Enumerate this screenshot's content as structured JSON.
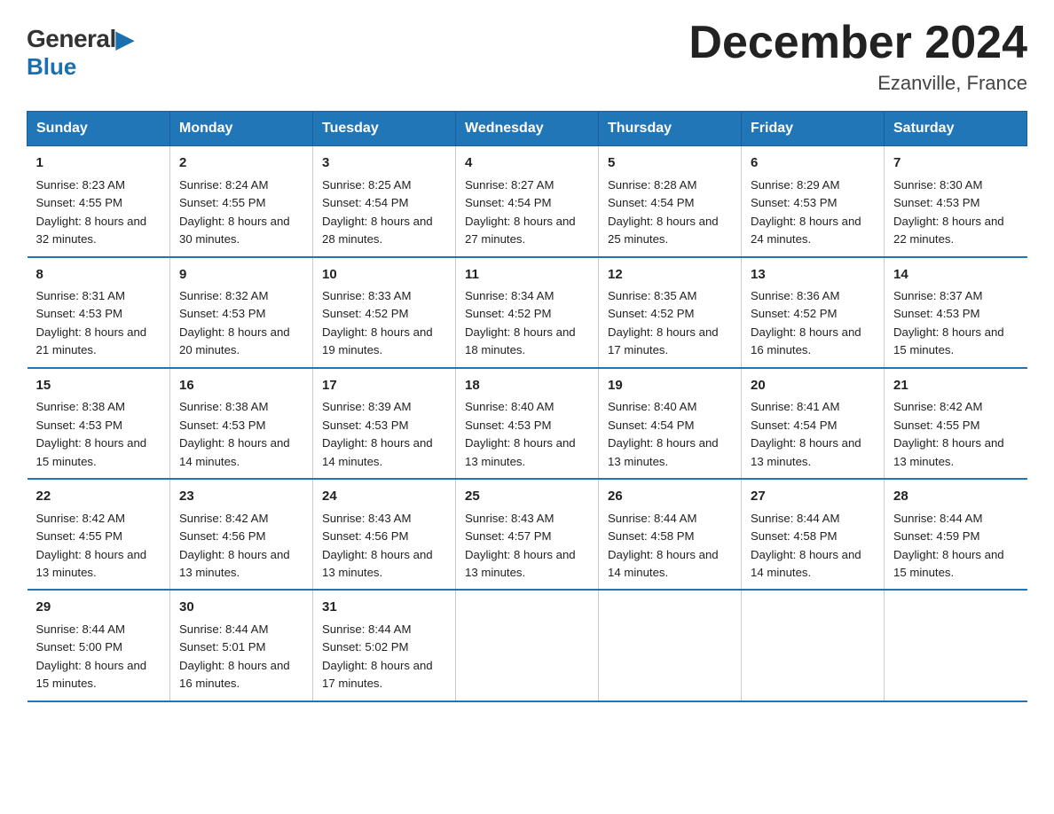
{
  "logo": {
    "general": "General",
    "blue": "Blue",
    "triangle": true
  },
  "title": "December 2024",
  "subtitle": "Ezanville, France",
  "days_of_week": [
    "Sunday",
    "Monday",
    "Tuesday",
    "Wednesday",
    "Thursday",
    "Friday",
    "Saturday"
  ],
  "weeks": [
    [
      {
        "day": "1",
        "sunrise": "8:23 AM",
        "sunset": "4:55 PM",
        "daylight": "8 hours and 32 minutes."
      },
      {
        "day": "2",
        "sunrise": "8:24 AM",
        "sunset": "4:55 PM",
        "daylight": "8 hours and 30 minutes."
      },
      {
        "day": "3",
        "sunrise": "8:25 AM",
        "sunset": "4:54 PM",
        "daylight": "8 hours and 28 minutes."
      },
      {
        "day": "4",
        "sunrise": "8:27 AM",
        "sunset": "4:54 PM",
        "daylight": "8 hours and 27 minutes."
      },
      {
        "day": "5",
        "sunrise": "8:28 AM",
        "sunset": "4:54 PM",
        "daylight": "8 hours and 25 minutes."
      },
      {
        "day": "6",
        "sunrise": "8:29 AM",
        "sunset": "4:53 PM",
        "daylight": "8 hours and 24 minutes."
      },
      {
        "day": "7",
        "sunrise": "8:30 AM",
        "sunset": "4:53 PM",
        "daylight": "8 hours and 22 minutes."
      }
    ],
    [
      {
        "day": "8",
        "sunrise": "8:31 AM",
        "sunset": "4:53 PM",
        "daylight": "8 hours and 21 minutes."
      },
      {
        "day": "9",
        "sunrise": "8:32 AM",
        "sunset": "4:53 PM",
        "daylight": "8 hours and 20 minutes."
      },
      {
        "day": "10",
        "sunrise": "8:33 AM",
        "sunset": "4:52 PM",
        "daylight": "8 hours and 19 minutes."
      },
      {
        "day": "11",
        "sunrise": "8:34 AM",
        "sunset": "4:52 PM",
        "daylight": "8 hours and 18 minutes."
      },
      {
        "day": "12",
        "sunrise": "8:35 AM",
        "sunset": "4:52 PM",
        "daylight": "8 hours and 17 minutes."
      },
      {
        "day": "13",
        "sunrise": "8:36 AM",
        "sunset": "4:52 PM",
        "daylight": "8 hours and 16 minutes."
      },
      {
        "day": "14",
        "sunrise": "8:37 AM",
        "sunset": "4:53 PM",
        "daylight": "8 hours and 15 minutes."
      }
    ],
    [
      {
        "day": "15",
        "sunrise": "8:38 AM",
        "sunset": "4:53 PM",
        "daylight": "8 hours and 15 minutes."
      },
      {
        "day": "16",
        "sunrise": "8:38 AM",
        "sunset": "4:53 PM",
        "daylight": "8 hours and 14 minutes."
      },
      {
        "day": "17",
        "sunrise": "8:39 AM",
        "sunset": "4:53 PM",
        "daylight": "8 hours and 14 minutes."
      },
      {
        "day": "18",
        "sunrise": "8:40 AM",
        "sunset": "4:53 PM",
        "daylight": "8 hours and 13 minutes."
      },
      {
        "day": "19",
        "sunrise": "8:40 AM",
        "sunset": "4:54 PM",
        "daylight": "8 hours and 13 minutes."
      },
      {
        "day": "20",
        "sunrise": "8:41 AM",
        "sunset": "4:54 PM",
        "daylight": "8 hours and 13 minutes."
      },
      {
        "day": "21",
        "sunrise": "8:42 AM",
        "sunset": "4:55 PM",
        "daylight": "8 hours and 13 minutes."
      }
    ],
    [
      {
        "day": "22",
        "sunrise": "8:42 AM",
        "sunset": "4:55 PM",
        "daylight": "8 hours and 13 minutes."
      },
      {
        "day": "23",
        "sunrise": "8:42 AM",
        "sunset": "4:56 PM",
        "daylight": "8 hours and 13 minutes."
      },
      {
        "day": "24",
        "sunrise": "8:43 AM",
        "sunset": "4:56 PM",
        "daylight": "8 hours and 13 minutes."
      },
      {
        "day": "25",
        "sunrise": "8:43 AM",
        "sunset": "4:57 PM",
        "daylight": "8 hours and 13 minutes."
      },
      {
        "day": "26",
        "sunrise": "8:44 AM",
        "sunset": "4:58 PM",
        "daylight": "8 hours and 14 minutes."
      },
      {
        "day": "27",
        "sunrise": "8:44 AM",
        "sunset": "4:58 PM",
        "daylight": "8 hours and 14 minutes."
      },
      {
        "day": "28",
        "sunrise": "8:44 AM",
        "sunset": "4:59 PM",
        "daylight": "8 hours and 15 minutes."
      }
    ],
    [
      {
        "day": "29",
        "sunrise": "8:44 AM",
        "sunset": "5:00 PM",
        "daylight": "8 hours and 15 minutes."
      },
      {
        "day": "30",
        "sunrise": "8:44 AM",
        "sunset": "5:01 PM",
        "daylight": "8 hours and 16 minutes."
      },
      {
        "day": "31",
        "sunrise": "8:44 AM",
        "sunset": "5:02 PM",
        "daylight": "8 hours and 17 minutes."
      },
      null,
      null,
      null,
      null
    ]
  ],
  "labels": {
    "sunrise_prefix": "Sunrise: ",
    "sunset_prefix": "Sunset: ",
    "daylight_prefix": "Daylight: "
  }
}
